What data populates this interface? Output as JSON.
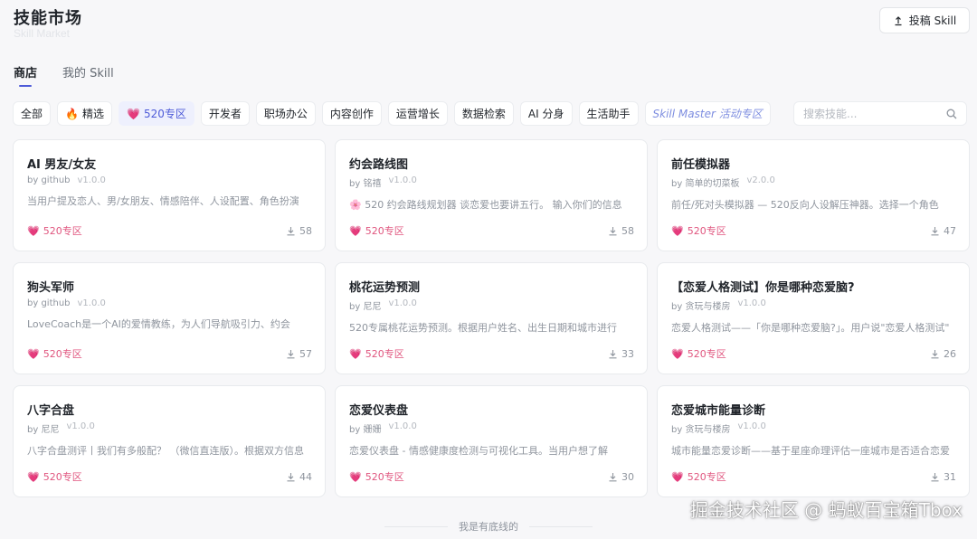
{
  "header": {
    "title": "技能市场",
    "subtitle": "Skill Market",
    "submit_label": "投稿 Skill"
  },
  "tabs": [
    {
      "label": "商店",
      "active": true
    },
    {
      "label": "我的 Skill",
      "active": false
    }
  ],
  "categories": [
    {
      "label": "全部",
      "icon": ""
    },
    {
      "label": "精选",
      "icon": "🔥"
    },
    {
      "label": "520专区",
      "icon": "💗",
      "active": true
    },
    {
      "label": "开发者",
      "icon": ""
    },
    {
      "label": "职场办公",
      "icon": ""
    },
    {
      "label": "内容创作",
      "icon": ""
    },
    {
      "label": "运营增长",
      "icon": ""
    },
    {
      "label": "数据检索",
      "icon": ""
    },
    {
      "label": "AI 分身",
      "icon": ""
    },
    {
      "label": "生活助手",
      "icon": ""
    },
    {
      "label": "Skill Master 活动专区",
      "icon": ""
    }
  ],
  "search": {
    "placeholder": "搜索技能..."
  },
  "badge_label": "520专区",
  "badge_icon": "💗",
  "cards": [
    {
      "title": "AI 男友/女友",
      "author": "by github",
      "version": "v1.0.0",
      "desc": "当用户提及恋人、男/女朋友、情感陪伴、人设配置、角色扮演",
      "downloads": "58"
    },
    {
      "title": "约会路线图",
      "author": "by 铭禧",
      "version": "v1.0.0",
      "desc": "🌸 520 约会路线规划器 谈恋爱也要讲五行。 输入你们的信息",
      "downloads": "58"
    },
    {
      "title": "前任模拟器",
      "author": "by 简单的切菜板",
      "version": "v2.0.0",
      "desc": "前任/死对头模拟器 — 520反向人设解压神器。选择一个角色",
      "downloads": "47"
    },
    {
      "title": "狗头军师",
      "author": "by github",
      "version": "v1.0.0",
      "desc": "LoveCoach是一个AI的爱情教练，为人们导航吸引力、约会",
      "downloads": "57"
    },
    {
      "title": "桃花运势预测",
      "author": "by 尼尼",
      "version": "v1.0.0",
      "desc": "520专属桃花运势预测。根据用户姓名、出生日期和城市进行",
      "downloads": "33"
    },
    {
      "title": "【恋爱人格测试】你是哪种恋爱脑?",
      "author": "by 贪玩与楼房",
      "version": "v1.0.0",
      "desc": "恋爱人格测试——「你是哪种恋爱脑?」。用户说\"恋爱人格测试\"",
      "downloads": "26"
    },
    {
      "title": "八字合盘",
      "author": "by 尼尼",
      "version": "v1.0.0",
      "desc": "八字合盘测评丨我们有多般配？ （微信直连版）。根据双方信息",
      "downloads": "44"
    },
    {
      "title": "恋爱仪表盘",
      "author": "by 姗姗",
      "version": "v1.0.0",
      "desc": "恋爱仪表盘 - 情感健康度检测与可视化工具。当用户想了解",
      "downloads": "30"
    },
    {
      "title": "恋爱城市能量诊断",
      "author": "by 贪玩与楼房",
      "version": "v1.0.0",
      "desc": "城市能量恋爱诊断——基于星座命理评估一座城市是否适合恋爱",
      "downloads": "31"
    }
  ],
  "footer": {
    "end_text": "我是有底线的"
  },
  "watermark": "掘金技术社区 @ 蚂蚁百宝箱Tbox"
}
